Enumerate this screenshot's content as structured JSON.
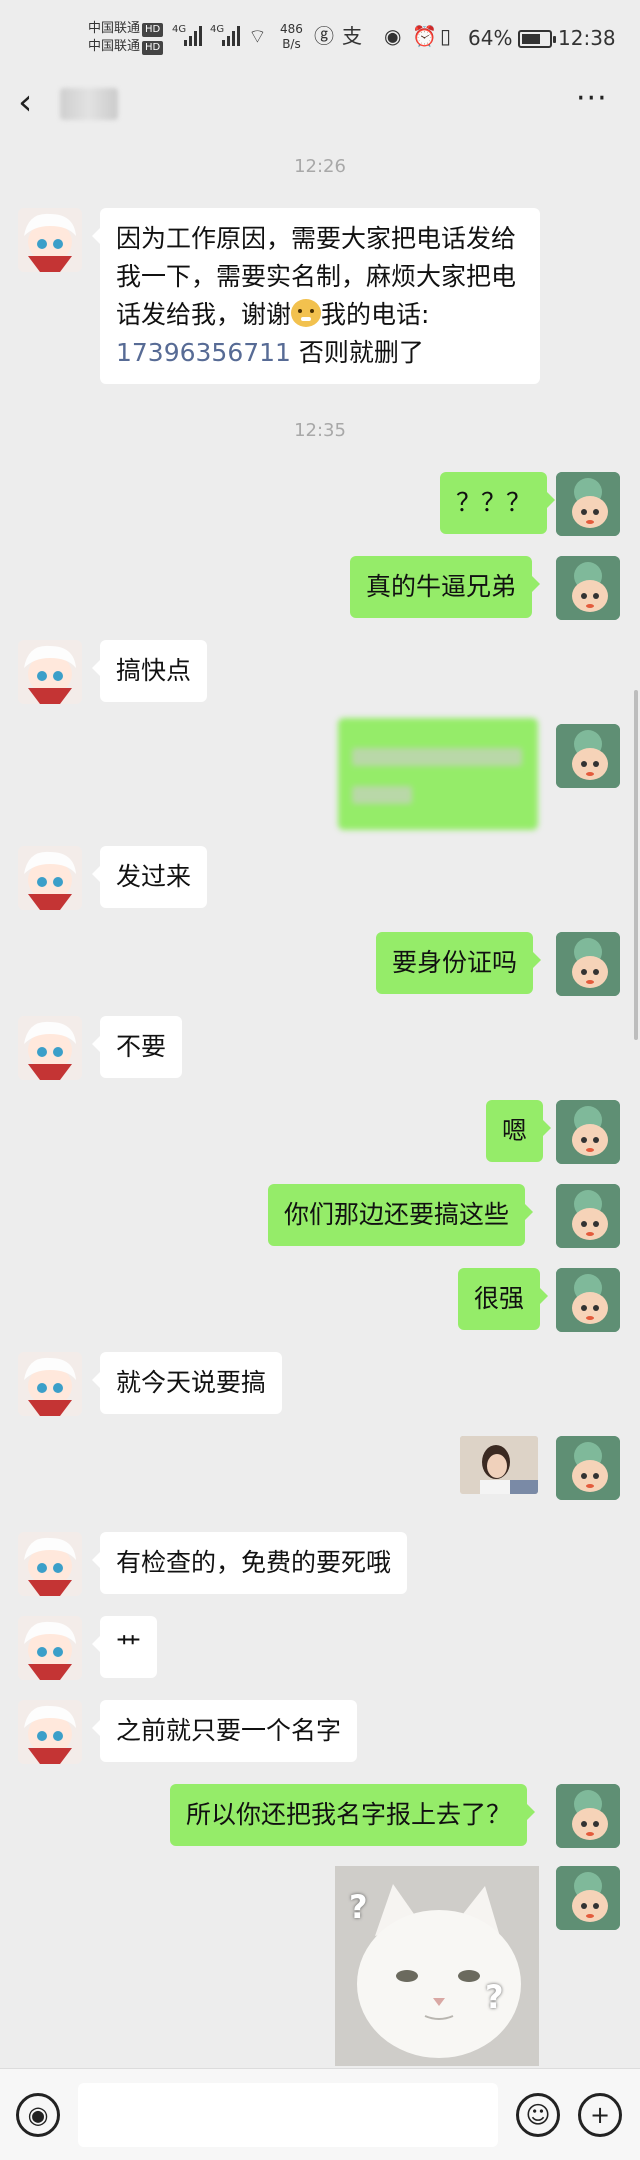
{
  "status_bar": {
    "carrier_1": "中国联通",
    "carrier_2": "中国联通",
    "hd_label": "HD",
    "network_label": "4G",
    "speed_value": "486",
    "speed_unit": "B/s",
    "battery_percent": "64%",
    "clock": "12:38"
  },
  "nav": {
    "back_icon": "chevron-left-icon",
    "more_icon": "more-dots-icon",
    "back_glyph": "‹",
    "more_glyph": "···"
  },
  "messages": [
    {
      "type": "time",
      "text": "12:26"
    },
    {
      "side": "left",
      "text_before": "因为工作原因，需要大家把电话发给我一下，需要实名制，麻烦大家把电话发给我，谢谢",
      "text_after": "我的电话:",
      "phone": "17396356711",
      "text_tail": " 否则就删了"
    },
    {
      "type": "time",
      "text": "12:35"
    },
    {
      "side": "right",
      "text": "？？？"
    },
    {
      "side": "right",
      "text": "真的牛逼兄弟"
    },
    {
      "side": "left",
      "text": "搞快点"
    },
    {
      "side": "left",
      "text": "发过来"
    },
    {
      "side": "right",
      "text": "要身份证吗"
    },
    {
      "side": "left",
      "text": "不要"
    },
    {
      "side": "right",
      "text": "嗯"
    },
    {
      "side": "right",
      "text": "你们那边还要搞这些"
    },
    {
      "side": "right",
      "text": "很强"
    },
    {
      "side": "left",
      "text": "就今天说要搞"
    },
    {
      "side": "left",
      "text": "有检查的，免费的要死哦"
    },
    {
      "side": "left",
      "text": "艹"
    },
    {
      "side": "left",
      "text": "之前就只要一个名字"
    },
    {
      "side": "right",
      "text": "所以你还把我名字报上去了？"
    }
  ],
  "cat_image": {
    "mark_1": "?",
    "mark_2": "?"
  },
  "input_bar": {
    "voice_icon": "voice-icon",
    "emoji_icon": "emoji-icon",
    "plus_icon": "plus-icon",
    "voice_glyph": "◉",
    "emoji_glyph": "☺",
    "plus_glyph": "+"
  },
  "colors": {
    "background": "#ededed",
    "bubble_self": "#95ec69",
    "bubble_other": "#ffffff",
    "link": "#576b95"
  }
}
